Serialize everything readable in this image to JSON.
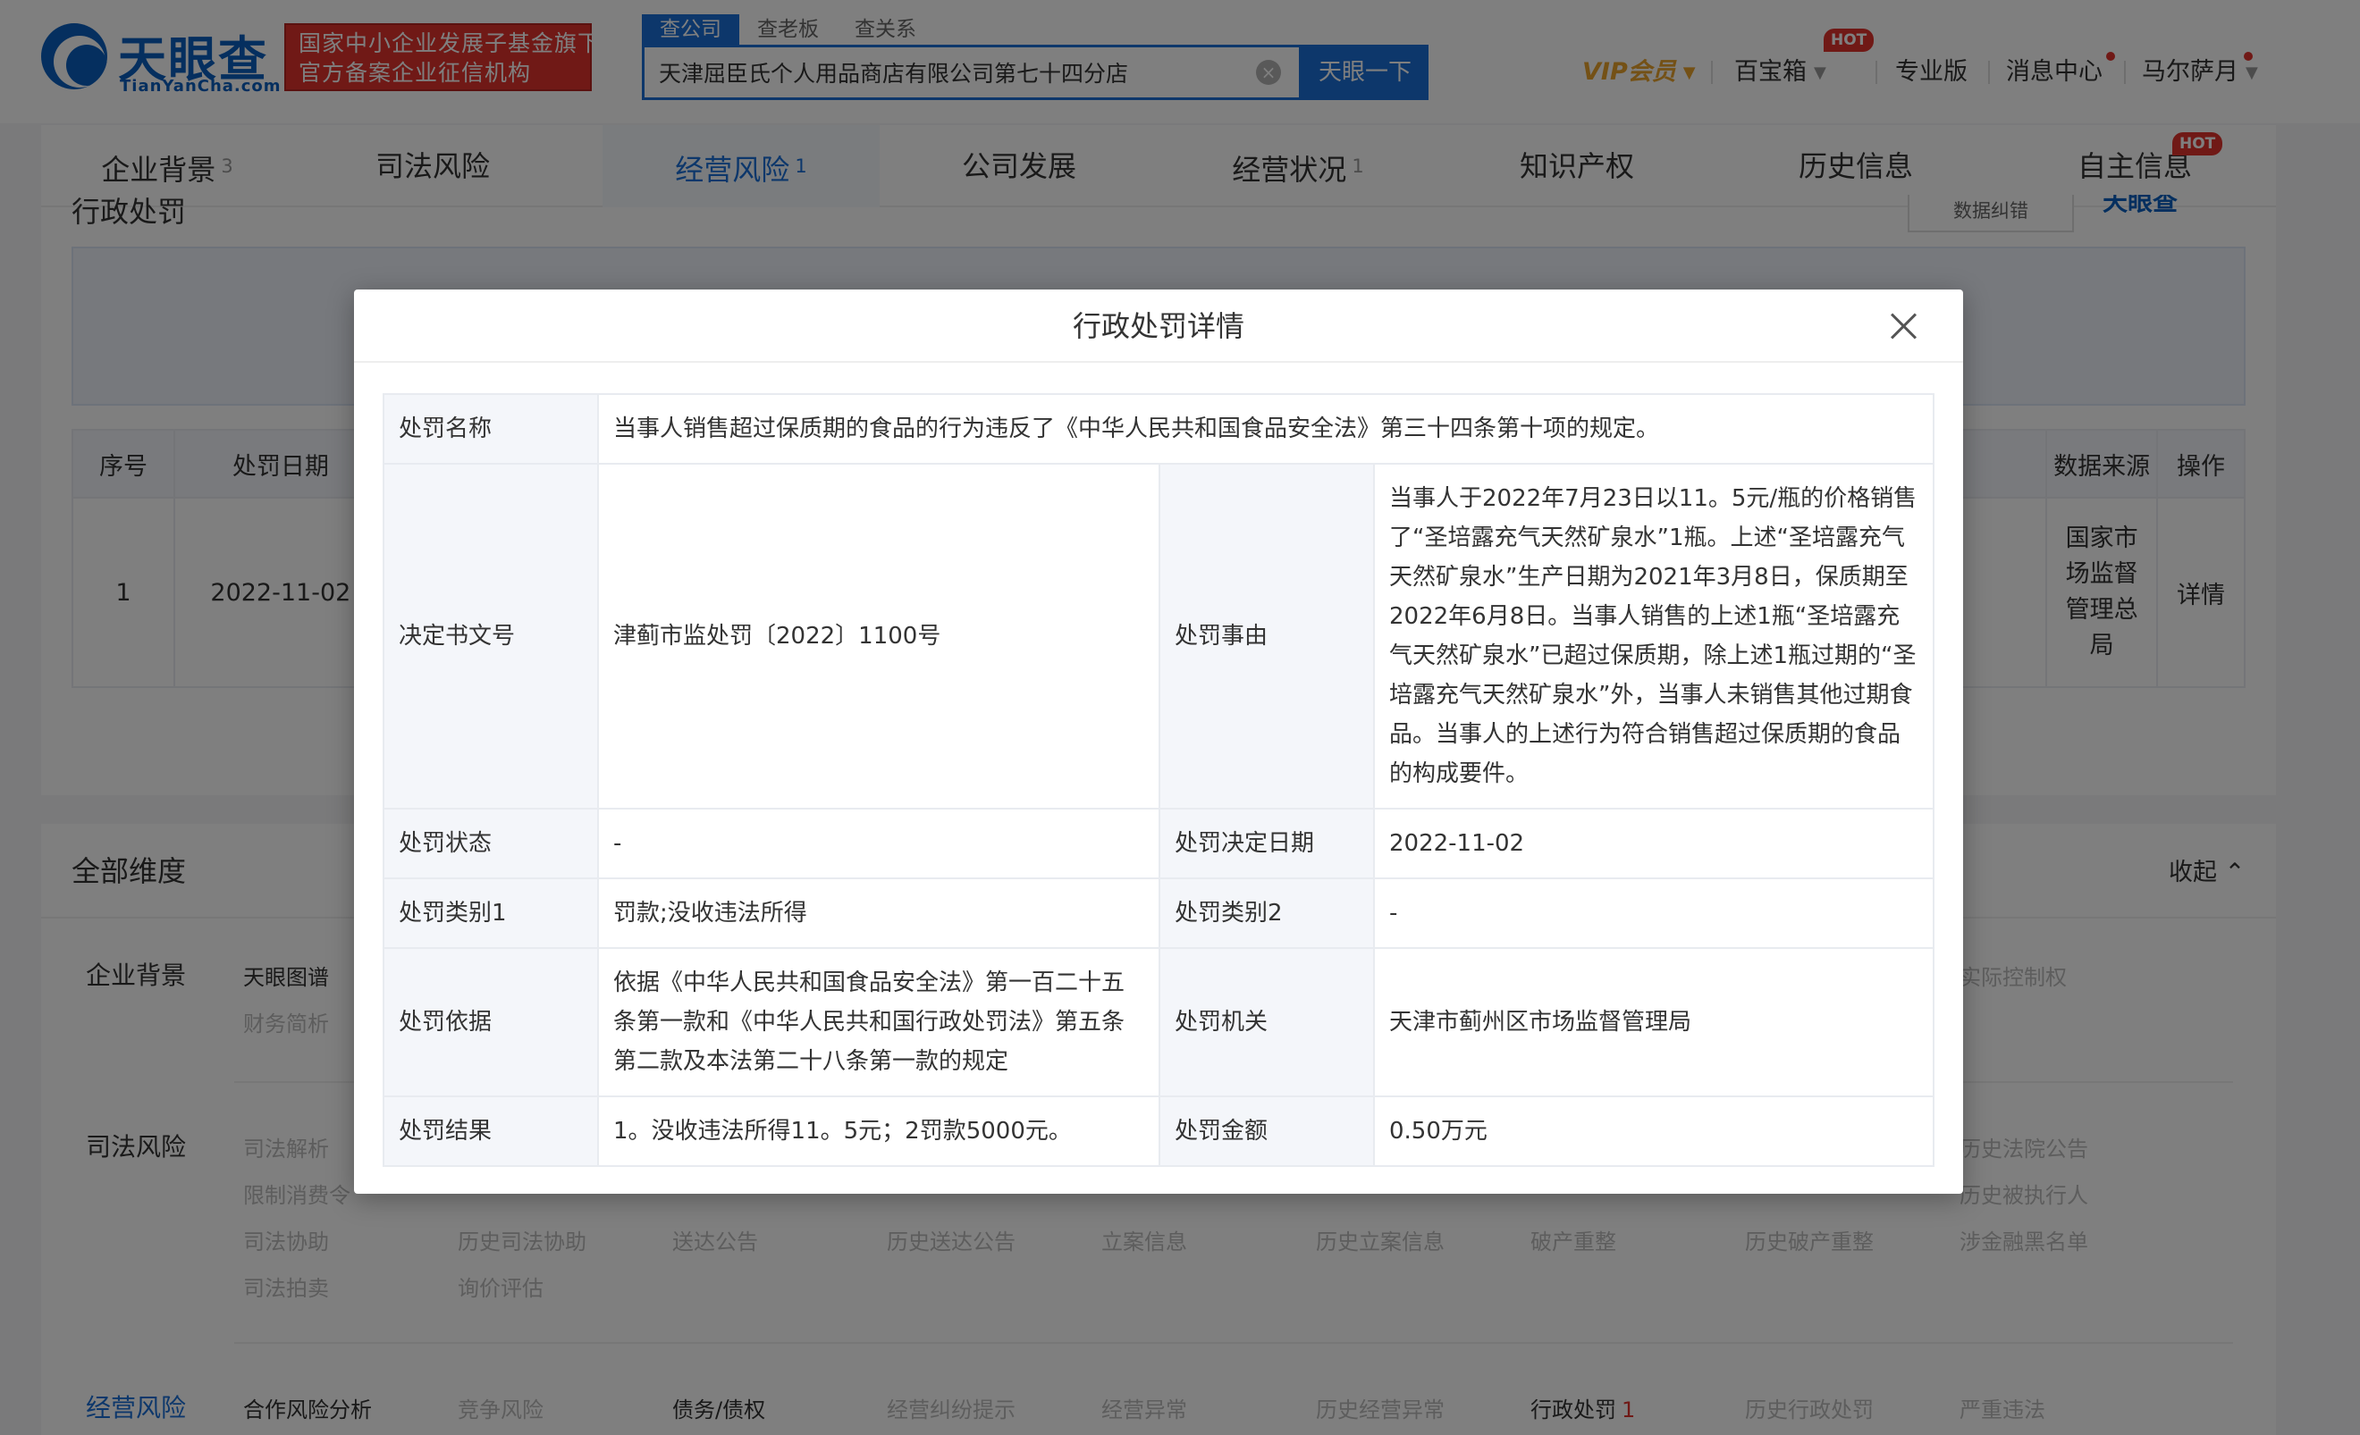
{
  "header": {
    "logo_name": "天眼查",
    "logo_url": "TianYanCha.com",
    "gov_badge_line1": "国家中小企业发展子基金旗下",
    "gov_badge_line2": "官方备案企业征信机构",
    "search_tabs": [
      "查公司",
      "查老板",
      "查关系"
    ],
    "search_value": "天津屈臣氏个人用品商店有限公司第七十四分店",
    "search_button": "天眼一下",
    "vip": "VIP会员",
    "baibaoxiang": "百宝箱",
    "hot": "HOT",
    "pro": "专业版",
    "messages": "消息中心",
    "user": "马尔萨月"
  },
  "main_tabs": [
    {
      "label": "企业背景",
      "count": "3"
    },
    {
      "label": "司法风险",
      "count": ""
    },
    {
      "label": "经营风险",
      "count": "1"
    },
    {
      "label": "公司发展",
      "count": ""
    },
    {
      "label": "经营状况",
      "count": "1"
    },
    {
      "label": "知识产权",
      "count": ""
    },
    {
      "label": "历史信息",
      "count": ""
    },
    {
      "label": "自主信息",
      "count": ""
    }
  ],
  "background": {
    "section_title_partial": "行政处罚",
    "tool_button": "数据纠错",
    "table_headers": {
      "index": "序号",
      "date": "处罚日期",
      "source": "数据来源",
      "action": "操作"
    },
    "row": {
      "index": "1",
      "date": "2022-11-02",
      "source": "国家市场监督管理总局",
      "action": "详情"
    },
    "dims_title": "全部维度",
    "collapse": "收起",
    "categories": {
      "enterprise": "企业背景",
      "judicial": "司法风险",
      "operating": "经营风险"
    },
    "enterprise_items": [
      "天眼图谱",
      "财务简析",
      "实际控制权"
    ],
    "judicial_row1": [
      "司法解析",
      "历史法院公告"
    ],
    "judicial_row2": [
      "限制消费令",
      "历史被执行人"
    ],
    "judicial_row3": [
      "司法协助",
      "历史司法协助",
      "送达公告",
      "历史送达公告",
      "立案信息",
      "历史立案信息",
      "破产重整",
      "历史破产重整",
      "涉金融黑名单"
    ],
    "judicial_row4": [
      "司法拍卖",
      "询价评估"
    ],
    "operating_items": [
      "合作风险分析",
      "竞争风险",
      "债务/债权",
      "经营纠纷提示",
      "经营异常",
      "历史经营异常",
      "行政处罚",
      "历史行政处罚",
      "严重违法"
    ],
    "operating_penalty_count": "1"
  },
  "modal": {
    "title": "行政处罚详情",
    "rows": {
      "name_label": "处罚名称",
      "name_value": "当事人销售超过保质期的食品的行为违反了《中华人民共和国食品安全法》第三十四条第十项的规定。",
      "doc_label": "决定书文号",
      "doc_value": "津蓟市监处罚〔2022〕1100号",
      "reason_label": "处罚事由",
      "reason_value": "当事人于2022年7月23日以11。5元/瓶的价格销售了“圣培露充气天然矿泉水”1瓶。上述“圣培露充气天然矿泉水”生产日期为2021年3月8日，保质期至2022年6月8日。当事人销售的上述1瓶“圣培露充气天然矿泉水”已超过保质期，除上述1瓶过期的“圣培露充气天然矿泉水”外，当事人未销售其他过期食品。当事人的上述行为符合销售超过保质期的食品的构成要件。",
      "status_label": "处罚状态",
      "status_value": "-",
      "decision_date_label": "处罚决定日期",
      "decision_date_value": "2022-11-02",
      "type1_label": "处罚类别1",
      "type1_value": "罚款;没收违法所得",
      "type2_label": "处罚类别2",
      "type2_value": "-",
      "basis_label": "处罚依据",
      "basis_value": "依据《中华人民共和国食品安全法》第一百二十五条第一款和《中华人民共和国行政处罚法》第五条第二款及本法第二十八条第一款的规定",
      "authority_label": "处罚机关",
      "authority_value": "天津市蓟州区市场监督管理局",
      "result_label": "处罚结果",
      "result_value": "1。没收违法所得11。5元；2罚款5000元。",
      "amount_label": "处罚金额",
      "amount_value": "0.50万元"
    }
  },
  "colors": {
    "brand_blue": "#0a5fbe",
    "accent_blue": "#1a6fd6",
    "badge_red": "#e0332c",
    "vip_gold": "#e8a22d"
  }
}
